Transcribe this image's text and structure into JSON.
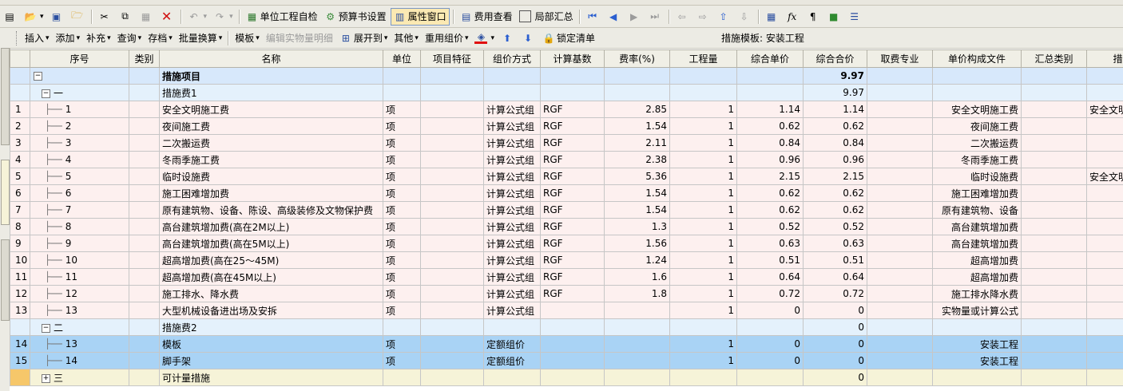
{
  "toolbar1": {
    "self_check": "单位工程自检",
    "budget_settings": "预算书设置",
    "property_window": "属性窗口",
    "cost_view": "费用查看",
    "partial_summary": "局部汇总"
  },
  "toolbar2": {
    "insert": "插入",
    "add": "添加",
    "supplement": "补充",
    "query": "查询",
    "archive": "存档",
    "batch_convert": "批量换算",
    "template": "模板",
    "edit_detail": "编辑实物量明细",
    "expand_to": "展开到",
    "other": "其他",
    "reuse_price": "重用组价",
    "lock_list": "锁定清单",
    "template_label": "措施模板: 安装工程"
  },
  "columns": [
    "序号",
    "类别",
    "名称",
    "单位",
    "项目特征",
    "组价方式",
    "计算基数",
    "费率(%)",
    "工程量",
    "综合单价",
    "综合合价",
    "取费专业",
    "单价构成文件",
    "汇总类别",
    "措施类"
  ],
  "rows": [
    {
      "type": "head",
      "rn": "",
      "seq": "",
      "cat": "",
      "name": "措施项目",
      "unit": "",
      "feat": "",
      "method": "",
      "base": "",
      "rate": "",
      "qty": "",
      "price": "",
      "total": "9.97",
      "fee": "",
      "compose": "",
      "sumcat": "",
      "mcat": ""
    },
    {
      "type": "grp",
      "rn": "",
      "seq": "一",
      "cat": "",
      "name": "措施费1",
      "unit": "",
      "feat": "",
      "method": "",
      "base": "",
      "rate": "",
      "qty": "",
      "price": "",
      "total": "9.97",
      "fee": "",
      "compose": "",
      "sumcat": "",
      "mcat": ""
    },
    {
      "type": "item",
      "rn": "1",
      "seq": "1",
      "cat": "",
      "name": "安全文明施工费",
      "unit": "项",
      "feat": "",
      "method": "计算公式组",
      "base": "RGF",
      "rate": "2.85",
      "qty": "1",
      "price": "1.14",
      "total": "1.14",
      "fee": "",
      "compose": "安全文明施工费",
      "sumcat": "",
      "mcat": "安全文明"
    },
    {
      "type": "item",
      "rn": "2",
      "seq": "2",
      "cat": "",
      "name": "夜间施工费",
      "unit": "项",
      "feat": "",
      "method": "计算公式组",
      "base": "RGF",
      "rate": "1.54",
      "qty": "1",
      "price": "0.62",
      "total": "0.62",
      "fee": "",
      "compose": "夜间施工费",
      "sumcat": "",
      "mcat": ""
    },
    {
      "type": "item",
      "rn": "3",
      "seq": "3",
      "cat": "",
      "name": "二次搬运费",
      "unit": "项",
      "feat": "",
      "method": "计算公式组",
      "base": "RGF",
      "rate": "2.11",
      "qty": "1",
      "price": "0.84",
      "total": "0.84",
      "fee": "",
      "compose": "二次搬运费",
      "sumcat": "",
      "mcat": ""
    },
    {
      "type": "item",
      "rn": "4",
      "seq": "4",
      "cat": "",
      "name": "冬雨季施工费",
      "unit": "项",
      "feat": "",
      "method": "计算公式组",
      "base": "RGF",
      "rate": "2.38",
      "qty": "1",
      "price": "0.96",
      "total": "0.96",
      "fee": "",
      "compose": "冬雨季施工费",
      "sumcat": "",
      "mcat": ""
    },
    {
      "type": "item",
      "rn": "5",
      "seq": "5",
      "cat": "",
      "name": "临时设施费",
      "unit": "项",
      "feat": "",
      "method": "计算公式组",
      "base": "RGF",
      "rate": "5.36",
      "qty": "1",
      "price": "2.15",
      "total": "2.15",
      "fee": "",
      "compose": "临时设施费",
      "sumcat": "",
      "mcat": "安全文明"
    },
    {
      "type": "item",
      "rn": "6",
      "seq": "6",
      "cat": "",
      "name": "施工困难增加费",
      "unit": "项",
      "feat": "",
      "method": "计算公式组",
      "base": "RGF",
      "rate": "1.54",
      "qty": "1",
      "price": "0.62",
      "total": "0.62",
      "fee": "",
      "compose": "施工困难增加费",
      "sumcat": "",
      "mcat": ""
    },
    {
      "type": "item",
      "rn": "7",
      "seq": "7",
      "cat": "",
      "name": "原有建筑物、设备、陈设、高级装修及文物保护费",
      "unit": "项",
      "feat": "",
      "method": "计算公式组",
      "base": "RGF",
      "rate": "1.54",
      "qty": "1",
      "price": "0.62",
      "total": "0.62",
      "fee": "",
      "compose": "原有建筑物、设备",
      "sumcat": "",
      "mcat": ""
    },
    {
      "type": "item",
      "rn": "8",
      "seq": "8",
      "cat": "",
      "name": "高台建筑增加费(高在2M以上)",
      "unit": "项",
      "feat": "",
      "method": "计算公式组",
      "base": "RGF",
      "rate": "1.3",
      "qty": "1",
      "price": "0.52",
      "total": "0.52",
      "fee": "",
      "compose": "高台建筑增加费",
      "sumcat": "",
      "mcat": ""
    },
    {
      "type": "item",
      "rn": "9",
      "seq": "9",
      "cat": "",
      "name": "高台建筑增加费(高在5M以上)",
      "unit": "项",
      "feat": "",
      "method": "计算公式组",
      "base": "RGF",
      "rate": "1.56",
      "qty": "1",
      "price": "0.63",
      "total": "0.63",
      "fee": "",
      "compose": "高台建筑增加费",
      "sumcat": "",
      "mcat": ""
    },
    {
      "type": "item",
      "rn": "10",
      "seq": "10",
      "cat": "",
      "name": "超高增加费(高在25～45M)",
      "unit": "项",
      "feat": "",
      "method": "计算公式组",
      "base": "RGF",
      "rate": "1.24",
      "qty": "1",
      "price": "0.51",
      "total": "0.51",
      "fee": "",
      "compose": "超高增加费",
      "sumcat": "",
      "mcat": ""
    },
    {
      "type": "item",
      "rn": "11",
      "seq": "11",
      "cat": "",
      "name": "超高增加费(高在45M以上)",
      "unit": "项",
      "feat": "",
      "method": "计算公式组",
      "base": "RGF",
      "rate": "1.6",
      "qty": "1",
      "price": "0.64",
      "total": "0.64",
      "fee": "",
      "compose": "超高增加费",
      "sumcat": "",
      "mcat": ""
    },
    {
      "type": "item",
      "rn": "12",
      "seq": "12",
      "cat": "",
      "name": "施工排水、降水费",
      "unit": "项",
      "feat": "",
      "method": "计算公式组",
      "base": "RGF",
      "rate": "1.8",
      "qty": "1",
      "price": "0.72",
      "total": "0.72",
      "fee": "",
      "compose": "施工排水降水费",
      "sumcat": "",
      "mcat": ""
    },
    {
      "type": "item",
      "rn": "13",
      "seq": "13",
      "cat": "",
      "name": "大型机械设备进出场及安拆",
      "unit": "项",
      "feat": "",
      "method": "计算公式组",
      "base": "",
      "rate": "",
      "qty": "1",
      "price": "0",
      "total": "0",
      "fee": "",
      "compose": "实物量或计算公式",
      "sumcat": "",
      "mcat": ""
    },
    {
      "type": "grp",
      "rn": "",
      "seq": "二",
      "cat": "",
      "name": "措施费2",
      "unit": "",
      "feat": "",
      "method": "",
      "base": "",
      "rate": "",
      "qty": "",
      "price": "",
      "total": "0",
      "fee": "",
      "compose": "",
      "sumcat": "",
      "mcat": ""
    },
    {
      "type": "sel",
      "rn": "14",
      "seq": "13",
      "cat": "",
      "name": "模板",
      "unit": "项",
      "feat": "",
      "method": "定额组价",
      "base": "",
      "rate": "",
      "qty": "1",
      "price": "0",
      "total": "0",
      "fee": "",
      "compose": "安装工程",
      "sumcat": "",
      "mcat": ""
    },
    {
      "type": "sel",
      "rn": "15",
      "seq": "14",
      "cat": "",
      "name": "脚手架",
      "unit": "项",
      "feat": "",
      "method": "定额组价",
      "base": "",
      "rate": "",
      "qty": "1",
      "price": "0",
      "total": "0",
      "fee": "",
      "compose": "安装工程",
      "sumcat": "",
      "mcat": ""
    },
    {
      "type": "cur",
      "rn": "",
      "seq": "三",
      "cat": "",
      "name": "可计量措施",
      "unit": "",
      "feat": "",
      "method": "",
      "base": "",
      "rate": "",
      "qty": "",
      "price": "",
      "total": "0",
      "fee": "",
      "compose": "",
      "sumcat": "",
      "mcat": ""
    }
  ]
}
